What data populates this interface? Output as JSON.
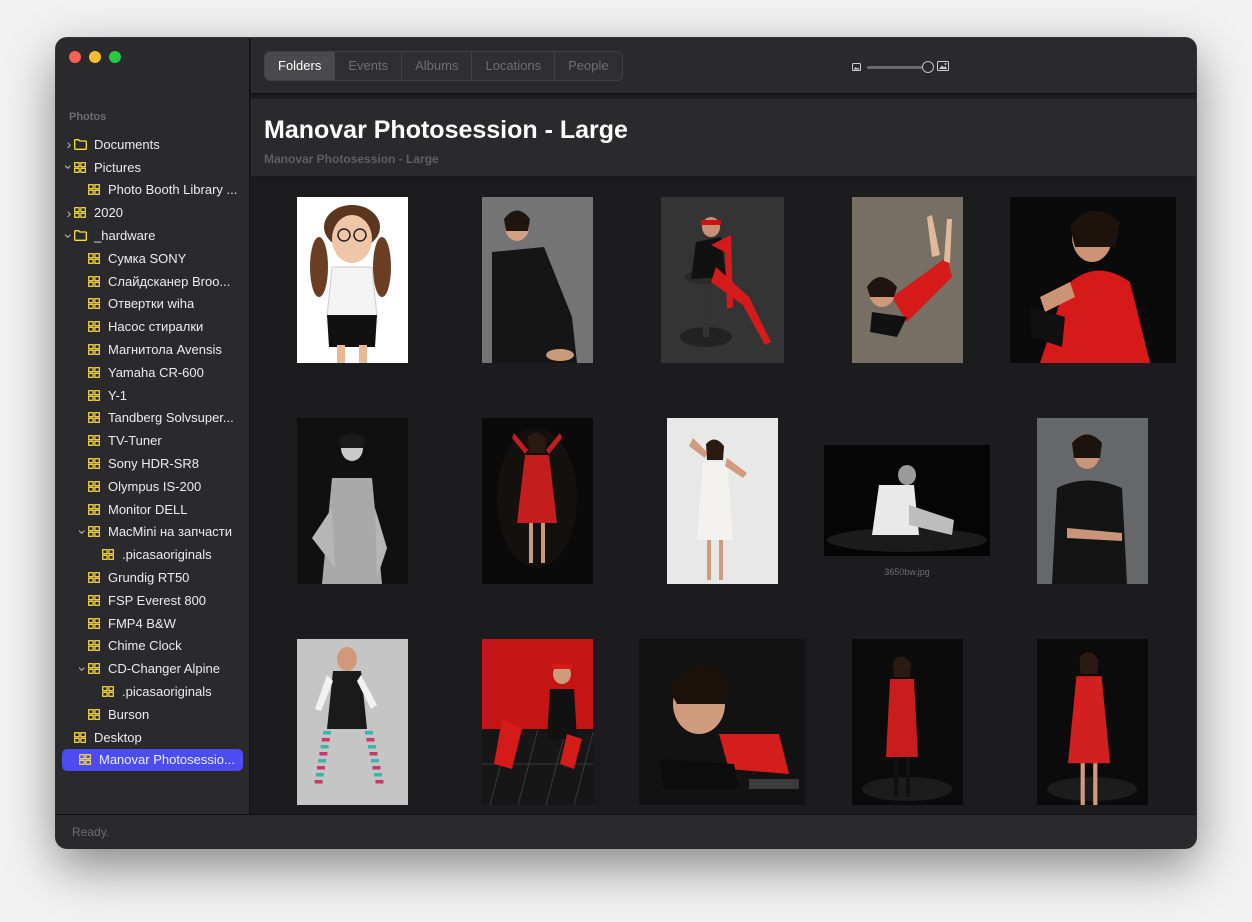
{
  "sidebar": {
    "section_label": "Photos",
    "items": [
      {
        "label": "Documents",
        "depth": 0,
        "chevron": "right",
        "icon": "folder-icon"
      },
      {
        "label": "Pictures",
        "depth": 0,
        "chevron": "down",
        "icon": "grid-folder-icon"
      },
      {
        "label": "Photo Booth Library ...",
        "depth": 1,
        "chevron": "",
        "icon": "grid-folder-icon"
      },
      {
        "label": "2020",
        "depth": 0,
        "chevron": "right",
        "icon": "grid-folder-icon"
      },
      {
        "label": "_hardware",
        "depth": 0,
        "chevron": "down",
        "icon": "folder-icon"
      },
      {
        "label": "Сумка SONY",
        "depth": 1,
        "chevron": "",
        "icon": "grid-folder-icon"
      },
      {
        "label": "Слайдсканер Broo...",
        "depth": 1,
        "chevron": "",
        "icon": "grid-folder-icon"
      },
      {
        "label": "Отвертки wiha",
        "depth": 1,
        "chevron": "",
        "icon": "grid-folder-icon"
      },
      {
        "label": "Насос стиралки",
        "depth": 1,
        "chevron": "",
        "icon": "grid-folder-icon"
      },
      {
        "label": "Магнитола Avensis",
        "depth": 1,
        "chevron": "",
        "icon": "grid-folder-icon"
      },
      {
        "label": "Yamaha CR-600",
        "depth": 1,
        "chevron": "",
        "icon": "grid-folder-icon"
      },
      {
        "label": "Y-1",
        "depth": 1,
        "chevron": "",
        "icon": "grid-folder-icon"
      },
      {
        "label": "Tandberg Solvsuper...",
        "depth": 1,
        "chevron": "",
        "icon": "grid-folder-icon"
      },
      {
        "label": "TV-Tuner",
        "depth": 1,
        "chevron": "",
        "icon": "grid-folder-icon"
      },
      {
        "label": "Sony HDR-SR8",
        "depth": 1,
        "chevron": "",
        "icon": "grid-folder-icon"
      },
      {
        "label": "Olympus IS-200",
        "depth": 1,
        "chevron": "",
        "icon": "grid-folder-icon"
      },
      {
        "label": "Monitor DELL",
        "depth": 1,
        "chevron": "",
        "icon": "grid-folder-icon"
      },
      {
        "label": "MacMini на запчасти",
        "depth": 1,
        "chevron": "down",
        "icon": "grid-folder-icon"
      },
      {
        "label": ".picasaoriginals",
        "depth": 2,
        "chevron": "",
        "icon": "grid-folder-icon"
      },
      {
        "label": "Grundig RT50",
        "depth": 1,
        "chevron": "",
        "icon": "grid-folder-icon"
      },
      {
        "label": "FSP Everest 800",
        "depth": 1,
        "chevron": "",
        "icon": "grid-folder-icon"
      },
      {
        "label": "FMP4 B&W",
        "depth": 1,
        "chevron": "",
        "icon": "grid-folder-icon"
      },
      {
        "label": "Chime Clock",
        "depth": 1,
        "chevron": "",
        "icon": "grid-folder-icon"
      },
      {
        "label": "CD-Changer Alpine",
        "depth": 1,
        "chevron": "down",
        "icon": "grid-folder-icon"
      },
      {
        "label": ".picasaoriginals",
        "depth": 2,
        "chevron": "",
        "icon": "grid-folder-icon"
      },
      {
        "label": "Burson",
        "depth": 1,
        "chevron": "",
        "icon": "grid-folder-icon"
      },
      {
        "label": "Desktop",
        "depth": 0,
        "chevron": "",
        "icon": "grid-folder-icon"
      },
      {
        "label": "Manovar Photosessio...",
        "depth": 0,
        "chevron": "",
        "icon": "grid-folder-icon",
        "selected": true
      }
    ]
  },
  "toolbar": {
    "tabs": [
      {
        "label": "Folders",
        "active": true
      },
      {
        "label": "Events",
        "active": false
      },
      {
        "label": "Albums",
        "active": false
      },
      {
        "label": "Locations",
        "active": false
      },
      {
        "label": "People",
        "active": false
      }
    ],
    "zoom": {
      "small_icon": "small-photo-icon",
      "large_icon": "large-photo-icon",
      "level": 0.95
    }
  },
  "header": {
    "title": "Manovar Photosession - Large",
    "subtitle": "Manovar Photosession - Large"
  },
  "grid": {
    "caption_3650": "3650bw.jpg",
    "photos": [
      {
        "name": "photo-white-glasses-girl",
        "scene": "white-bg-girl"
      },
      {
        "name": "photo-phone-woman",
        "scene": "grey-phone"
      },
      {
        "name": "photo-red-stool",
        "scene": "red-stool"
      },
      {
        "name": "photo-red-floor",
        "scene": "red-floor"
      },
      {
        "name": "photo-red-dress-closeup",
        "scene": "red-closeup"
      },
      {
        "name": "photo-bw-tank",
        "scene": "bw-tank"
      },
      {
        "name": "photo-red-dress-dark",
        "scene": "red-dress-dark"
      },
      {
        "name": "photo-white-lace-dress",
        "scene": "white-lace"
      },
      {
        "name": "photo-3650bw",
        "scene": "bw-sitting",
        "caption_key": "caption_3650"
      },
      {
        "name": "photo-black-dress-grey",
        "scene": "black-dress-grey"
      },
      {
        "name": "photo-striped-stockings",
        "scene": "striped"
      },
      {
        "name": "photo-red-wall-floor",
        "scene": "red-wall"
      },
      {
        "name": "photo-lying-red",
        "scene": "lying-red"
      },
      {
        "name": "photo-red-dress-spot",
        "scene": "red-spot"
      },
      {
        "name": "photo-red-dress-spot-2",
        "scene": "red-spot-2"
      }
    ]
  },
  "status": {
    "text": "Ready."
  },
  "colors": {
    "accent": "#4b4cf2",
    "folder_icon": "#ffe23b",
    "window_bg": "#1c1c1e",
    "sidebar_bg": "#2a2a2c"
  }
}
